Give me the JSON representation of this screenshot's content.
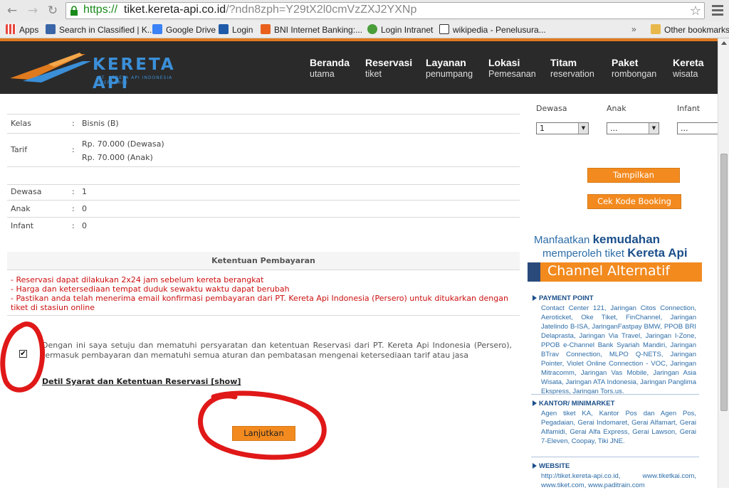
{
  "browser": {
    "url_scheme": "https://",
    "url_host": "tiket.kereta-api.co.id",
    "url_path": "/?ndn8zph=Y29tX2l0cmVzZXJ2YXNp"
  },
  "bookmarks": {
    "items": [
      {
        "label": "Apps",
        "icon": "apps-grid-icon",
        "color": "#e8453c"
      },
      {
        "label": "Search in Classified | K...",
        "icon": "classified-icon",
        "color": "#3a66a8"
      },
      {
        "label": "Google Drive",
        "icon": "google-icon",
        "color": "#3b82f6"
      },
      {
        "label": "Login",
        "icon": "login-icon",
        "color": "#1e5aa8"
      },
      {
        "label": "BNI Internet Banking:...",
        "icon": "bni-icon",
        "color": "#e8601c"
      },
      {
        "label": "Login Intranet",
        "icon": "intranet-icon",
        "color": "#4a9e3a"
      },
      {
        "label": "wikipedia - Penelusura...",
        "icon": "wikipedia-icon",
        "color": "#222222"
      }
    ],
    "overflow": "»",
    "other": "Other bookmarks"
  },
  "header": {
    "logo_title": "KERETA API",
    "logo_subtitle": "PT. KERETA API INDONESIA (PERSERO)",
    "menu": [
      {
        "title": "Beranda",
        "sub": "utama"
      },
      {
        "title": "Reservasi",
        "sub": "tiket"
      },
      {
        "title": "Layanan",
        "sub": "penumpang"
      },
      {
        "title": "Lokasi",
        "sub": "Pemesanan"
      },
      {
        "title": "Titam",
        "sub": "reservation"
      },
      {
        "title": "Paket",
        "sub": "rombongan"
      },
      {
        "title": "Kereta",
        "sub": "wisata"
      }
    ]
  },
  "booking": {
    "kelas_label": "Kelas",
    "kelas_value": "Bisnis (B)",
    "tarif_label": "Tarif",
    "tarif_dewasa": "Rp. 70.000 (Dewasa)",
    "tarif_anak": "Rp. 70.000 (Anak)",
    "dewasa_label": "Dewasa",
    "dewasa_value": "1",
    "anak_label": "Anak",
    "anak_value": "0",
    "infant_label": "Infant",
    "infant_value": "0",
    "colon": ":"
  },
  "ketentuan": {
    "heading": "Ketentuan Pembayaran",
    "line1": "- Reservasi dapat dilakukan 2x24 jam sebelum kereta berangkat",
    "line2": "- Harga dan ketersediaan tempat duduk sewaktu waktu dapat berubah",
    "line3": "- Pastikan anda telah menerima email konfirmasi pembayaran dari PT. Kereta Api Indonesia (Persero) untuk ditukarkan dengan tiket di stasiun online"
  },
  "agreement": {
    "checked": true,
    "checkmark": "✔",
    "text": "Dengan ini saya setuju dan mematuhi persyaratan dan ketentuan Reservasi dari PT. Kereta Api Indonesia (Persero), termasuk pembayaran dan mematuhi semua aturan dan pembatasan mengenai ketersediaan tarif atau jasa",
    "detail_link": "Detil Syarat dan Ketentuan Reservasi [show]",
    "continue_label": "Lanjutkan"
  },
  "sidebar": {
    "dewasa_label": "Dewasa",
    "anak_label": "Anak",
    "infant_label": "Infant",
    "dewasa_selected": "1",
    "anak_selected": "...",
    "infant_selected": "...",
    "tampilkan_label": "Tampilkan",
    "cek_kode_label": "Cek Kode Booking",
    "promo": {
      "line1_prefix": "Manfaatkan ",
      "line1_bold": "kemudahan",
      "line2_prefix": "memperoleh tiket ",
      "line2_bold": "Kereta Api",
      "channel": "Channel Alternatif",
      "payment_head": "PAYMENT POINT",
      "payment_body": "Contact Center 121, Jaringan Citos Connection, Aeroticket, Oke Tiket, FinChannel, Jaringan Jatelindo B-ISA, JaringanFastpay BMW, PPOB BRI Delaprasta, Jaringan Via Travel, Jaringan I-Zone, PPOB e-Channel Bank Syariah Mandiri, Jaringan BTrav Connection, MLPO Q-NETS, Jaringan Pointer, Violet Online Connection - VOC, Jaringan Mitracomm, Jaringan Vas Mobile, Jaringan Asia Wisata, Jaringan ATA Indonesia, Jaringan Panglima Ekspress, Jaringan Tors.us.",
      "kantor_head": "KANTOR/ MINIMARKET",
      "kantor_body": "Agen tiket KA, Kantor Pos dan Agen Pos, Pegadaian, Gerai Indomaret, Gerai Alfamart, Gerai Alfamidi, Gerai Alfa Express, Gerai Lawson, Gerai 7-Eleven, Coopay, Tiki JNE.",
      "website_head": "WEBSITE",
      "website_body": "http://tiket.kereta-api.co.id, www.tiketkai.com, www.tiket.com, www.paditrain.com"
    }
  },
  "colors": {
    "accent_orange": "#f38a1f",
    "header_dark": "#2a2a2a",
    "logo_blue": "#3b8fd8",
    "terms_red": "#cc1010",
    "annotation_red": "#e01818",
    "promo_navy": "#1b4f8a"
  }
}
